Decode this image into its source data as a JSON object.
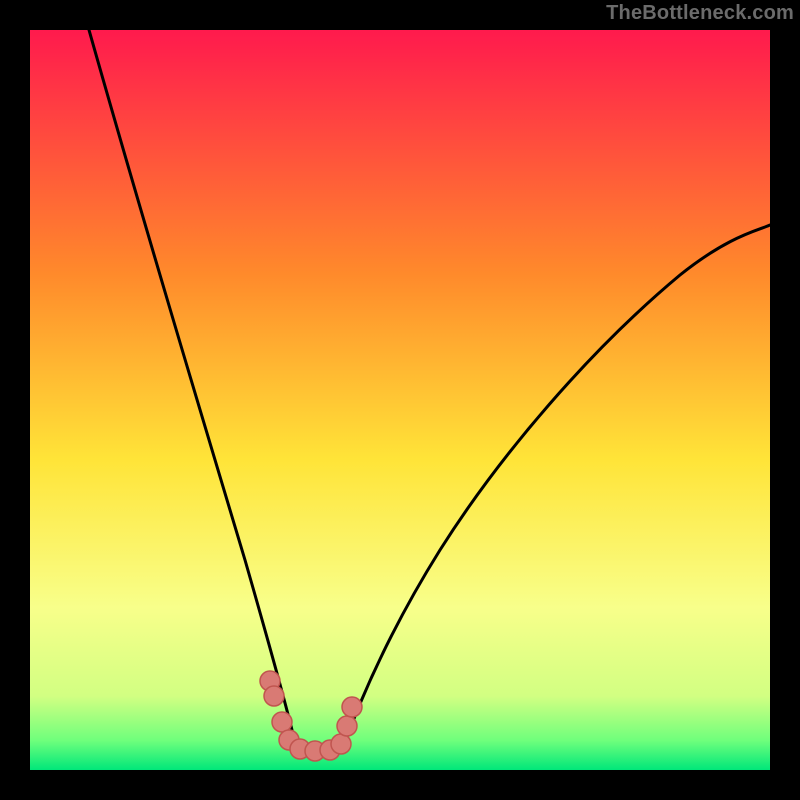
{
  "watermark": {
    "text": "TheBottleneck.com"
  },
  "chart_data": {
    "type": "line",
    "title": "",
    "xlabel": "",
    "ylabel": "",
    "xlim": [
      0,
      100
    ],
    "ylim": [
      0,
      100
    ],
    "grid": false,
    "legend": false,
    "series": [
      {
        "name": "left-curve",
        "x": [
          8,
          12,
          16,
          20,
          24,
          26,
          28,
          30,
          32,
          33,
          34,
          35,
          36
        ],
        "y": [
          100,
          83,
          67,
          51,
          36,
          29,
          23,
          17,
          11,
          8,
          6,
          4,
          3
        ]
      },
      {
        "name": "right-curve",
        "x": [
          42,
          44,
          46,
          50,
          55,
          60,
          66,
          74,
          82,
          90,
          98,
          100
        ],
        "y": [
          3,
          5,
          8,
          14,
          22,
          30,
          38,
          48,
          57,
          65,
          72,
          74
        ]
      },
      {
        "name": "salmon-markers",
        "x": [
          32.5,
          33.0,
          34.0,
          35.0,
          36.5,
          38.5,
          40.5,
          42.0,
          42.8,
          43.5
        ],
        "y": [
          12.0,
          10.0,
          6.5,
          4.0,
          2.8,
          2.6,
          2.7,
          3.5,
          6.0,
          8.5
        ]
      }
    ],
    "colors": {
      "curve": "#000000",
      "markers_fill": "#d97a74",
      "markers_stroke": "#c0554f",
      "gradient_stops": [
        {
          "offset": 0,
          "color": "#ff1a4d"
        },
        {
          "offset": 33,
          "color": "#ff8a2b"
        },
        {
          "offset": 58,
          "color": "#ffe438"
        },
        {
          "offset": 78,
          "color": "#f8ff8a"
        },
        {
          "offset": 90,
          "color": "#d2ff82"
        },
        {
          "offset": 96,
          "color": "#6fff7c"
        },
        {
          "offset": 100,
          "color": "#00e77a"
        }
      ]
    }
  }
}
